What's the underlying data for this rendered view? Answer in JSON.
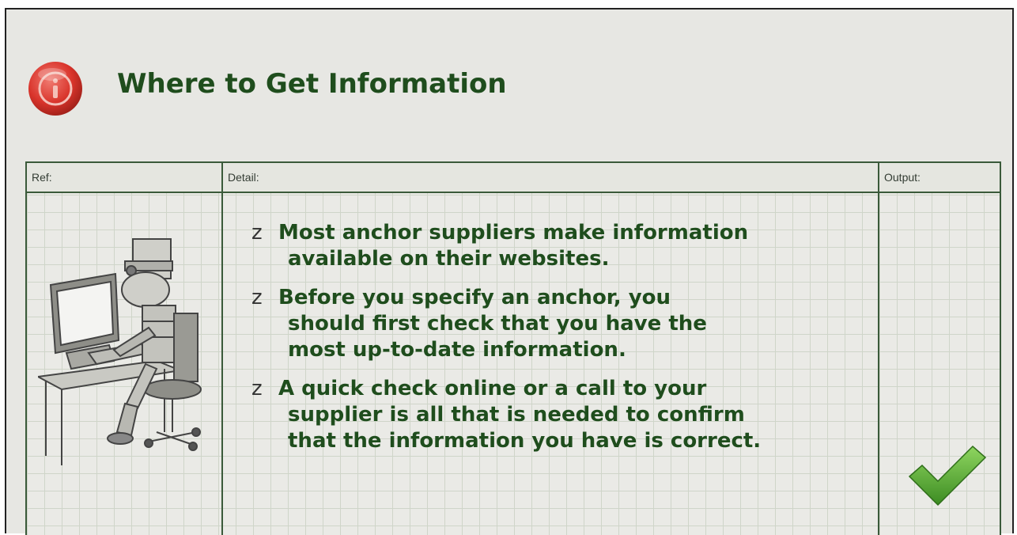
{
  "title": "Where to Get Information",
  "table": {
    "headers": {
      "ref": "Ref:",
      "detail": "Detail:",
      "output": "Output:"
    }
  },
  "bullets": [
    {
      "marker": "z",
      "lines": [
        "Most anchor suppliers make information",
        "available on their websites."
      ]
    },
    {
      "marker": "z",
      "lines": [
        "Before you specify an anchor, you",
        "should first check that you have the",
        "most up-to-date information."
      ]
    },
    {
      "marker": "z",
      "lines": [
        "A quick check online or a call to your",
        "supplier is all that is needed to confirm",
        "that the information you have is correct."
      ]
    }
  ],
  "icons": {
    "header": "info-icon",
    "illustration": "person-at-computer",
    "output": "checkmark-icon"
  },
  "colors": {
    "title": "#1f4d1d",
    "info": "#d9342b",
    "check": "#4ea52b"
  }
}
